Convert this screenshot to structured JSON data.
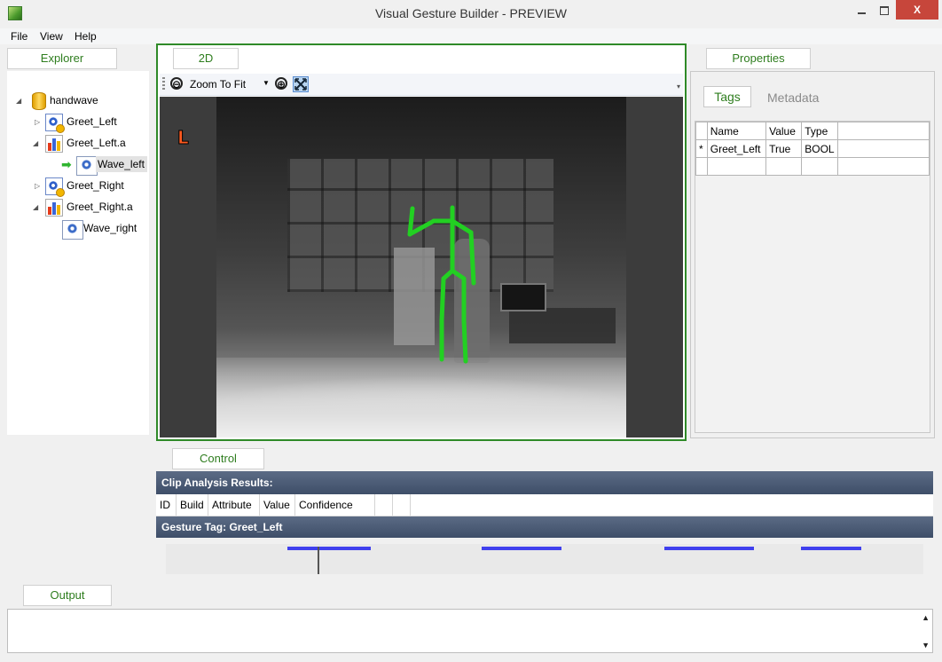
{
  "window": {
    "title": "Visual Gesture Builder - PREVIEW",
    "close_glyph": "X"
  },
  "menu": [
    "File",
    "View",
    "Help"
  ],
  "explorer": {
    "tab_label": "Explorer",
    "tree": {
      "root": "handwave",
      "items": [
        "Greet_Left",
        "Greet_Left.a",
        "Wave_left",
        "Greet_Right",
        "Greet_Right.a",
        "Wave_right"
      ]
    }
  },
  "view2d": {
    "tab_label": "2D",
    "zoom_label": "Zoom To Fit",
    "zoom_out_glyph": "⊖",
    "zoom_in_glyph": "⊕",
    "side_marker": "L",
    "skeleton_color": "#22d022"
  },
  "properties": {
    "tab_label": "Properties",
    "subtabs": {
      "active": "Tags",
      "inactive": "Metadata"
    },
    "table": {
      "headers": [
        "Name",
        "Value",
        "Type"
      ],
      "row_marker": "*",
      "rows": [
        {
          "name": "Greet_Left",
          "value": "True",
          "type": "BOOL"
        }
      ]
    }
  },
  "control": {
    "tab_label": "Control",
    "clip_analysis_label": "Clip Analysis Results:",
    "columns": [
      "ID",
      "Build",
      "Attribute",
      "Value",
      "Confidence"
    ],
    "gesture_tag_label": "Gesture Tag: Greet_Left",
    "segment_color": "#4040ee"
  },
  "output": {
    "tab_label": "Output"
  }
}
